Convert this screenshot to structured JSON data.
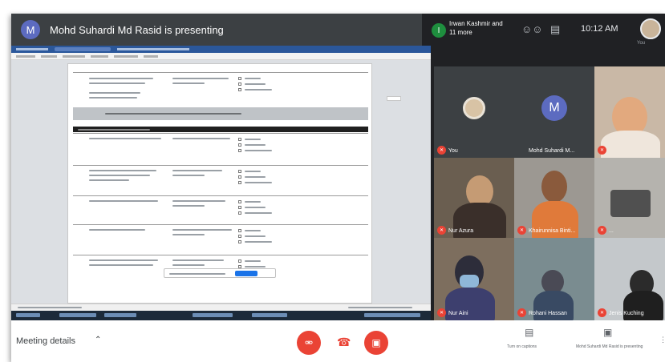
{
  "presenter": {
    "avatar_letter": "M",
    "text": "Mohd Suhardi Md Rasid is presenting"
  },
  "topbar": {
    "guest_badge": "I",
    "guest_name": "Irwan Kashmir and 11 more",
    "icons": [
      "people-icon",
      "chat-icon"
    ],
    "clock": "10:12 AM",
    "self_label": "You"
  },
  "participants": [
    {
      "name": "You",
      "muted": true
    },
    {
      "name": "Mohd Suhardi M...",
      "muted": false,
      "avatar_letter": "M"
    },
    {
      "name": "",
      "muted": true
    },
    {
      "name": "Nur Azura",
      "muted": true
    },
    {
      "name": "Khairunnisa Binti...",
      "muted": true
    },
    {
      "name": "...",
      "muted": true
    },
    {
      "name": "Nur Aini",
      "muted": true
    },
    {
      "name": "Rohani Hassan",
      "muted": true
    },
    {
      "name": "Jenis Kuching",
      "muted": true
    }
  ],
  "bottom_bar": {
    "meeting_details": "Meeting details",
    "captions_label": "Turn on captions",
    "present_label": "Mohd Suhardi Md Rasid is presenting"
  },
  "colors": {
    "mic_off": "#ea4335",
    "presenter_bar": "#3c4043",
    "doc_titlebar": "#2b579a"
  }
}
